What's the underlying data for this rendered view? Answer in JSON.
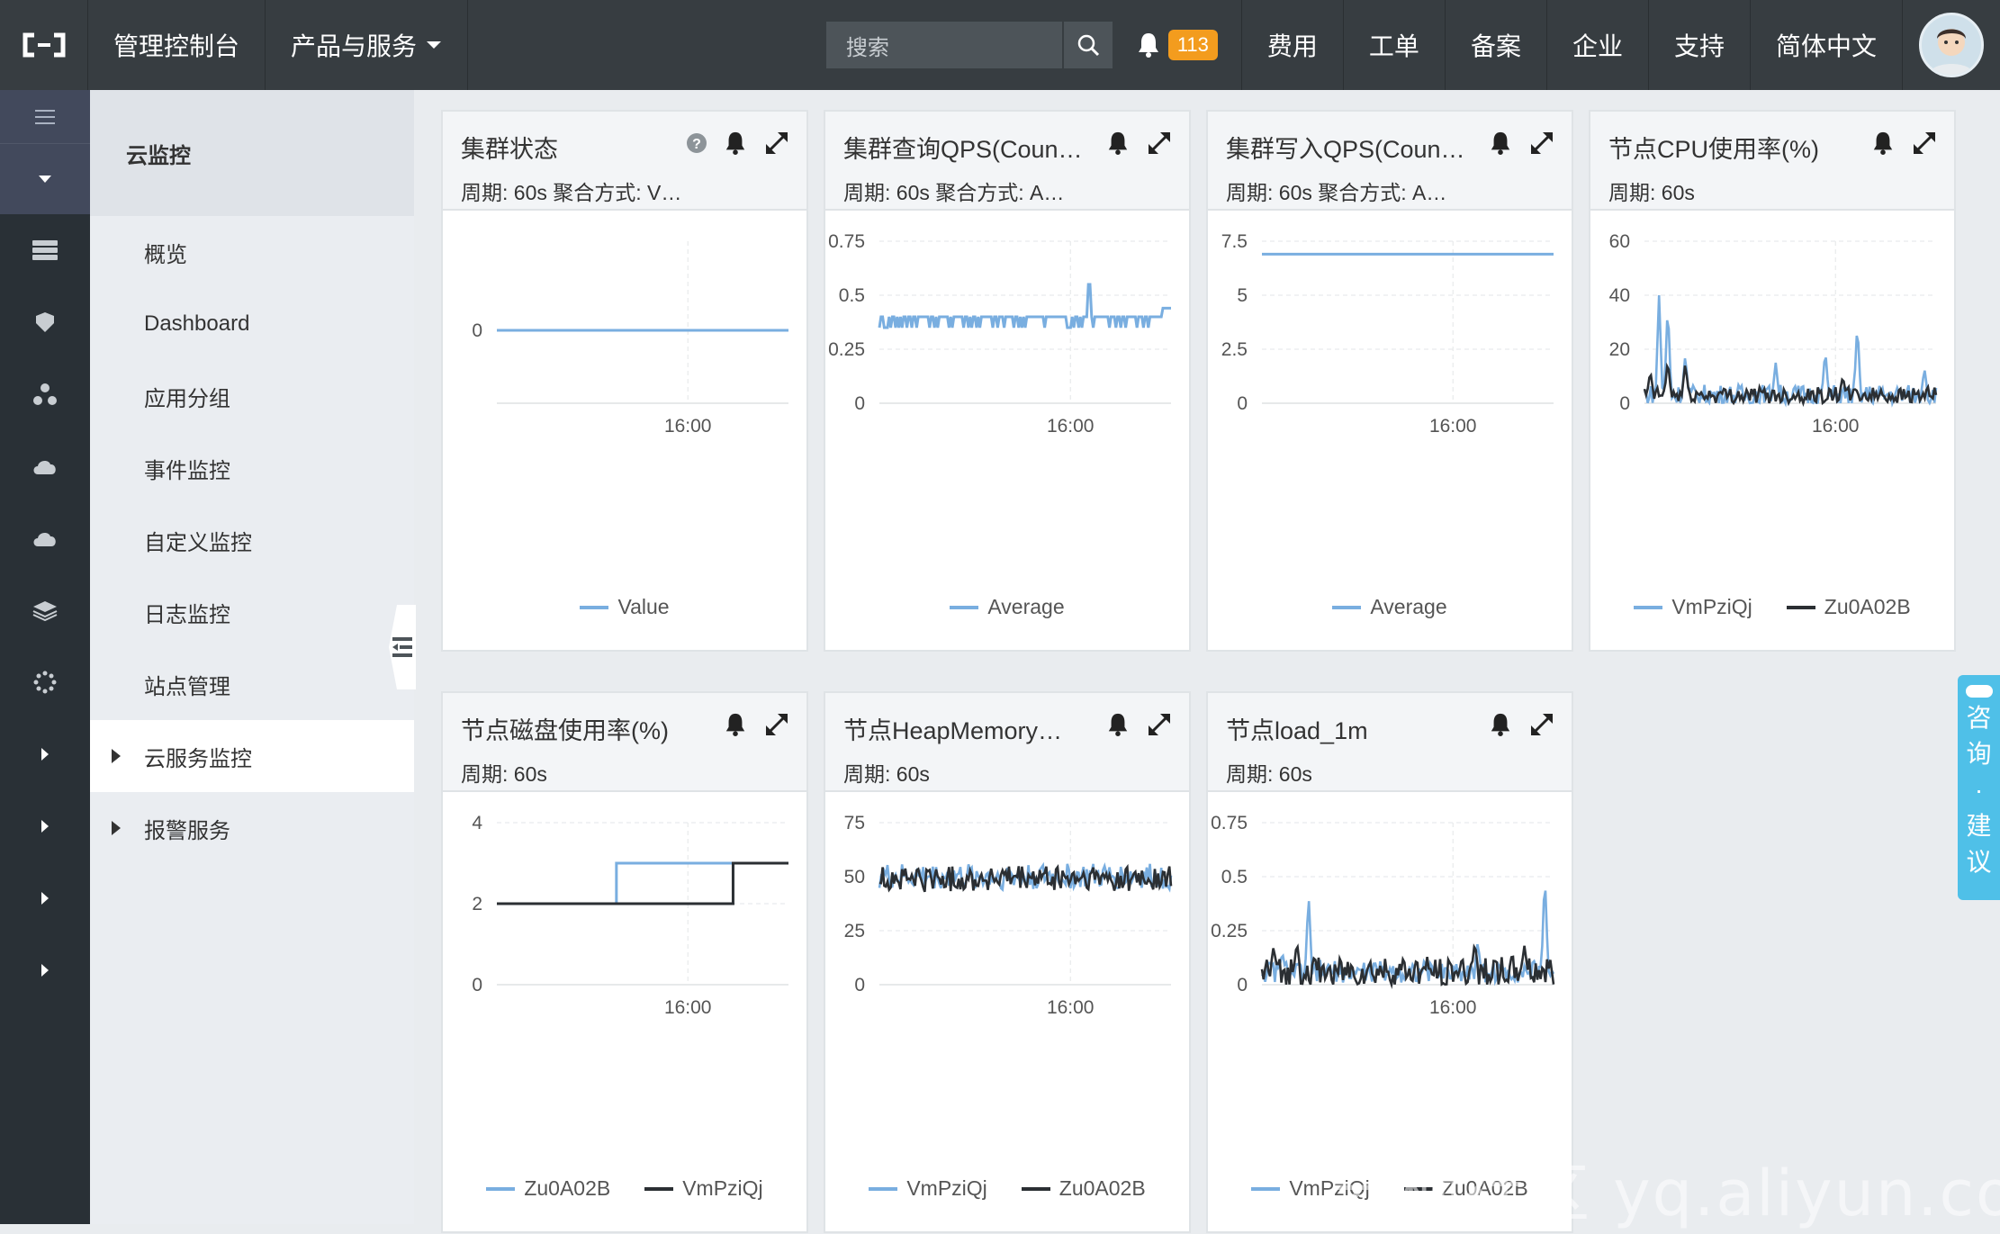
{
  "topbar": {
    "console": "管理控制台",
    "products": "产品与服务",
    "search_placeholder": "搜索",
    "notifications": "113",
    "links": [
      "费用",
      "工单",
      "备案",
      "企业",
      "支持",
      "简体中文"
    ]
  },
  "sidebar": {
    "header": "云监控",
    "items": [
      "概览",
      "Dashboard",
      "应用分组",
      "事件监控",
      "自定义监控",
      "日志监控",
      "站点管理",
      "云服务监控",
      "报警服务"
    ]
  },
  "colors": {
    "blue": "#79aee0",
    "dark": "#2b2f33",
    "accent": "#4fc0e8",
    "badge": "#f39c1e"
  },
  "floating_button": [
    "咨",
    "询",
    "·",
    "建",
    "议"
  ],
  "watermark": "云栖社区 yq.aliyun.com",
  "chart_data": [
    {
      "type": "line",
      "title": "集群状态",
      "subtitle": "周期: 60s  聚合方式: V…",
      "ylim": [
        0,
        0
      ],
      "yticks": [
        "0"
      ],
      "xticks": [
        "16:00"
      ],
      "series": [
        {
          "name": "Value",
          "color": "#79aee0",
          "style": "flat",
          "level": 0
        }
      ]
    },
    {
      "type": "line",
      "title": "集群查询QPS(Coun…",
      "subtitle": "周期: 60s  聚合方式: A…",
      "ylim": [
        0,
        0.75
      ],
      "yticks": [
        "0",
        "0.25",
        "0.5",
        "0.75"
      ],
      "xticks": [
        "16:00"
      ],
      "series": [
        {
          "name": "Average",
          "color": "#79aee0",
          "style": "spiky",
          "level": 0.4,
          "low": 0.35,
          "spike": 0.55
        }
      ]
    },
    {
      "type": "line",
      "title": "集群写入QPS(Coun…",
      "subtitle": "周期: 60s  聚合方式: A…",
      "ylim": [
        0,
        7.5
      ],
      "yticks": [
        "0",
        "2.5",
        "5",
        "7.5"
      ],
      "xticks": [
        "16:00"
      ],
      "series": [
        {
          "name": "Average",
          "color": "#79aee0",
          "style": "flat",
          "level": 6.9
        }
      ]
    },
    {
      "type": "line",
      "title": "节点CPU使用率(%)",
      "subtitle": "周期: 60s",
      "ylim": [
        0,
        60
      ],
      "yticks": [
        "0",
        "20",
        "40",
        "60"
      ],
      "xticks": [
        "16:00"
      ],
      "series": [
        {
          "name": "VmPziQj",
          "color": "#79aee0",
          "style": "noisy",
          "level": 3,
          "amp": 4,
          "peaks": [
            [
              0.05,
              40
            ],
            [
              0.08,
              37
            ],
            [
              0.14,
              18
            ],
            [
              0.45,
              15
            ],
            [
              0.62,
              20
            ],
            [
              0.73,
              30
            ],
            [
              0.96,
              13
            ]
          ]
        },
        {
          "name": "Zu0A02B",
          "color": "#2b2f33",
          "style": "noisy",
          "level": 3,
          "amp": 3,
          "peaks": [
            [
              0.02,
              12
            ],
            [
              0.08,
              16
            ],
            [
              0.14,
              15
            ],
            [
              0.68,
              10
            ]
          ]
        }
      ]
    },
    {
      "type": "line",
      "title": "节点磁盘使用率(%)",
      "subtitle": "周期: 60s",
      "ylim": [
        0,
        4
      ],
      "yticks": [
        "0",
        "2",
        "4"
      ],
      "xticks": [
        "16:00"
      ],
      "series": [
        {
          "name": "Zu0A02B",
          "color": "#79aee0",
          "style": "step",
          "from": 2,
          "to": 3,
          "at": 0.41
        },
        {
          "name": "VmPziQj",
          "color": "#2b2f33",
          "style": "step",
          "from": 2,
          "to": 3,
          "at": 0.81
        }
      ]
    },
    {
      "type": "line",
      "title": "节点HeapMemory…",
      "subtitle": "周期: 60s",
      "ylim": [
        0,
        75
      ],
      "yticks": [
        "0",
        "25",
        "50",
        "75"
      ],
      "xticks": [
        "16:00"
      ],
      "series": [
        {
          "name": "VmPziQj",
          "color": "#79aee0",
          "style": "noisy",
          "level": 50,
          "amp": 6,
          "peaks": []
        },
        {
          "name": "Zu0A02B",
          "color": "#2b2f33",
          "style": "noisy",
          "level": 49,
          "amp": 6,
          "peaks": []
        }
      ]
    },
    {
      "type": "line",
      "title": "节点load_1m",
      "subtitle": "周期: 60s",
      "ylim": [
        0,
        0.75
      ],
      "yticks": [
        "0",
        "0.25",
        "0.5",
        "0.75"
      ],
      "xticks": [
        "16:00"
      ],
      "series": [
        {
          "name": "VmPziQj",
          "color": "#79aee0",
          "style": "noisy",
          "level": 0.06,
          "amp": 0.05,
          "peaks": [
            [
              0.16,
              0.42
            ],
            [
              0.07,
              0.15
            ],
            [
              0.74,
              0.2
            ],
            [
              0.97,
              0.52
            ]
          ]
        },
        {
          "name": "Zu0A02B",
          "color": "#2b2f33",
          "style": "noisy",
          "level": 0.06,
          "amp": 0.07,
          "peaks": [
            [
              0.12,
              0.2
            ],
            [
              0.04,
              0.18
            ],
            [
              0.73,
              0.2
            ],
            [
              0.9,
              0.18
            ]
          ]
        }
      ]
    }
  ]
}
